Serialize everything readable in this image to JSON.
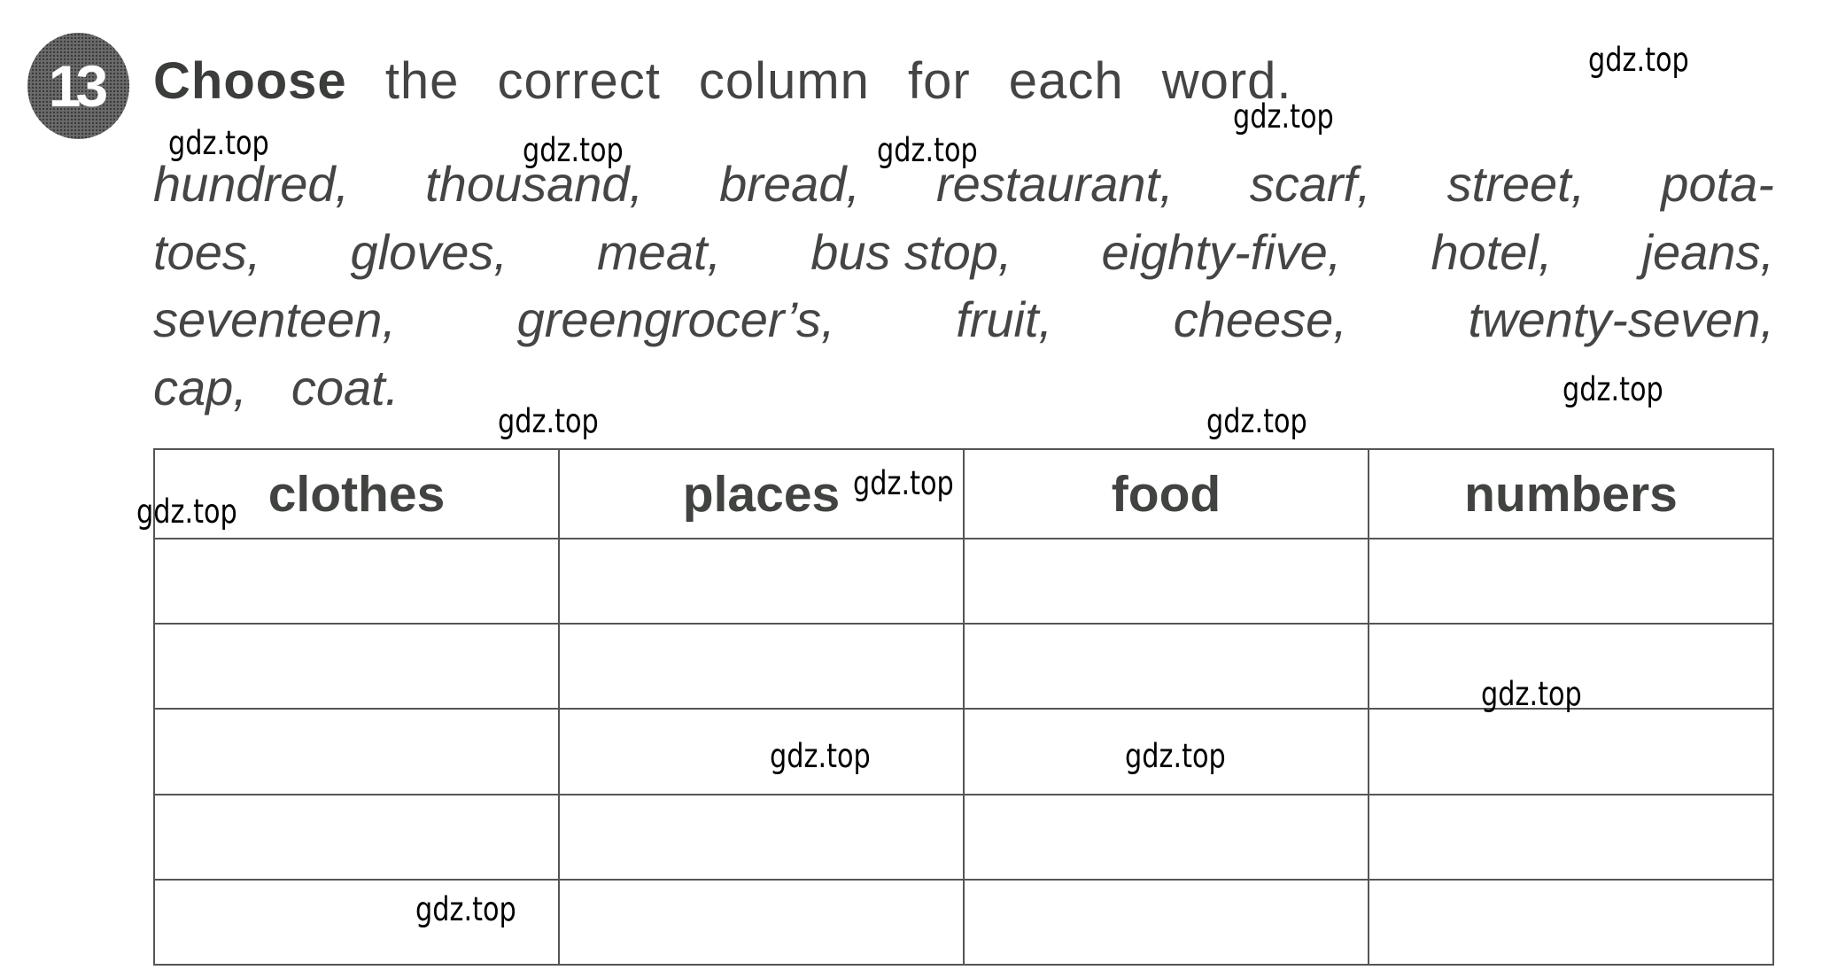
{
  "exercise": {
    "number": "13",
    "instruction_bold": "Choose",
    "instruction_rest": "the correct column for each word."
  },
  "word_lines": [
    [
      "hundred,",
      "thousand,",
      "bread,",
      "restaurant,",
      "scarf,",
      "street,",
      "pota-"
    ],
    [
      "toes,",
      "gloves,",
      "meat,",
      "bus stop,",
      "eighty-five,",
      "hotel,",
      "jeans,"
    ],
    [
      "seventeen,",
      "greengrocer’s,",
      "fruit,",
      "cheese,",
      "twenty-seven,"
    ],
    [
      "cap,",
      "coat."
    ]
  ],
  "table": {
    "headers": [
      "clothes",
      "places",
      "food",
      "numbers"
    ],
    "rows": [
      [
        "",
        "",
        "",
        ""
      ],
      [
        "",
        "",
        "",
        ""
      ],
      [
        "",
        "",
        "",
        ""
      ],
      [
        "",
        "",
        "",
        ""
      ],
      [
        "",
        "",
        "",
        ""
      ]
    ]
  },
  "watermark": "gdz.top"
}
